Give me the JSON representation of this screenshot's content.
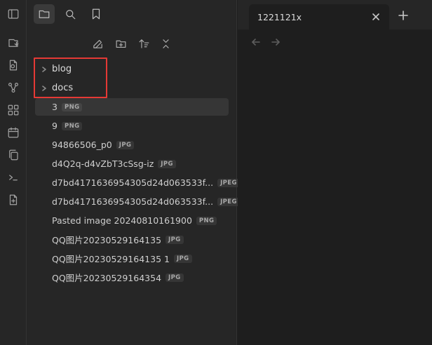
{
  "ribbon": {
    "icons": [
      "sidebar-toggle-icon",
      "switch-vault-icon",
      "file-sync-icon",
      "graph-icon",
      "canvas-icon",
      "calendar-icon",
      "copy-icon",
      "terminal-icon",
      "new-note-icon"
    ]
  },
  "sidebar": {
    "tabs": [
      "folder-icon",
      "search-icon",
      "bookmark-icon"
    ],
    "actions": [
      "new-note-icon",
      "new-folder-icon",
      "sort-icon",
      "collapse-all-icon"
    ],
    "folders": [
      {
        "label": "blog"
      },
      {
        "label": "docs"
      }
    ],
    "files": [
      {
        "name": "3",
        "ext": "PNG"
      },
      {
        "name": "9",
        "ext": "PNG"
      },
      {
        "name": "94866506_p0",
        "ext": "JPG"
      },
      {
        "name": "d4Q2q-d4vZbT3cSsg-iz",
        "ext": "JPG"
      },
      {
        "name": "d7bd4171636954305d24d063533f...",
        "ext": "JPEG"
      },
      {
        "name": "d7bd4171636954305d24d063533f...",
        "ext": "JPEG"
      },
      {
        "name": "Pasted image 20240810161900",
        "ext": "PNG"
      },
      {
        "name": "QQ图片20230529164135",
        "ext": "JPG"
      },
      {
        "name": "QQ图片20230529164135 1",
        "ext": "JPG"
      },
      {
        "name": "QQ图片20230529164354",
        "ext": "JPG"
      }
    ]
  },
  "main": {
    "tab": {
      "title": "1221121x"
    }
  },
  "colors": {
    "highlight": "#e53935",
    "background": "#1e1e1e",
    "panel": "#262626"
  }
}
